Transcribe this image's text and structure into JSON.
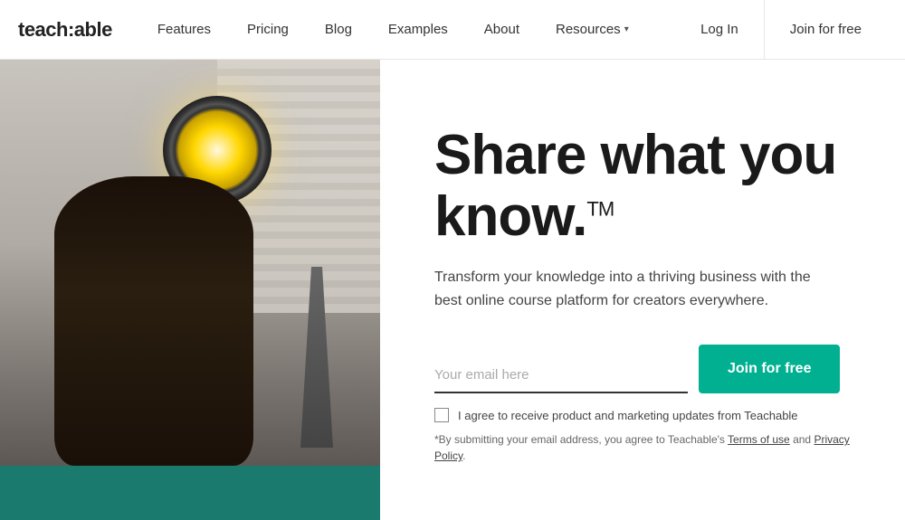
{
  "nav": {
    "logo": "teach:able",
    "links": [
      {
        "label": "Features",
        "id": "features"
      },
      {
        "label": "Pricing",
        "id": "pricing"
      },
      {
        "label": "Blog",
        "id": "blog"
      },
      {
        "label": "Examples",
        "id": "examples"
      },
      {
        "label": "About",
        "id": "about"
      },
      {
        "label": "Resources",
        "id": "resources"
      }
    ],
    "login_label": "Log In",
    "join_label": "Join for free"
  },
  "hero": {
    "heading_line1": "Share what you",
    "heading_line2": "know.",
    "tm": "TM",
    "subtext": "Transform your knowledge into a thriving business with the best online course platform for creators everywhere.",
    "email_placeholder": "Your email here",
    "join_button": "Join for free",
    "checkbox_label": "I agree to receive product and marketing updates from Teachable",
    "fine_print_before": "*By submitting your email address, you agree to Teachable's ",
    "terms_label": "Terms of use",
    "and_text": " and ",
    "privacy_label": "Privacy Policy",
    "fine_print_after": "."
  }
}
